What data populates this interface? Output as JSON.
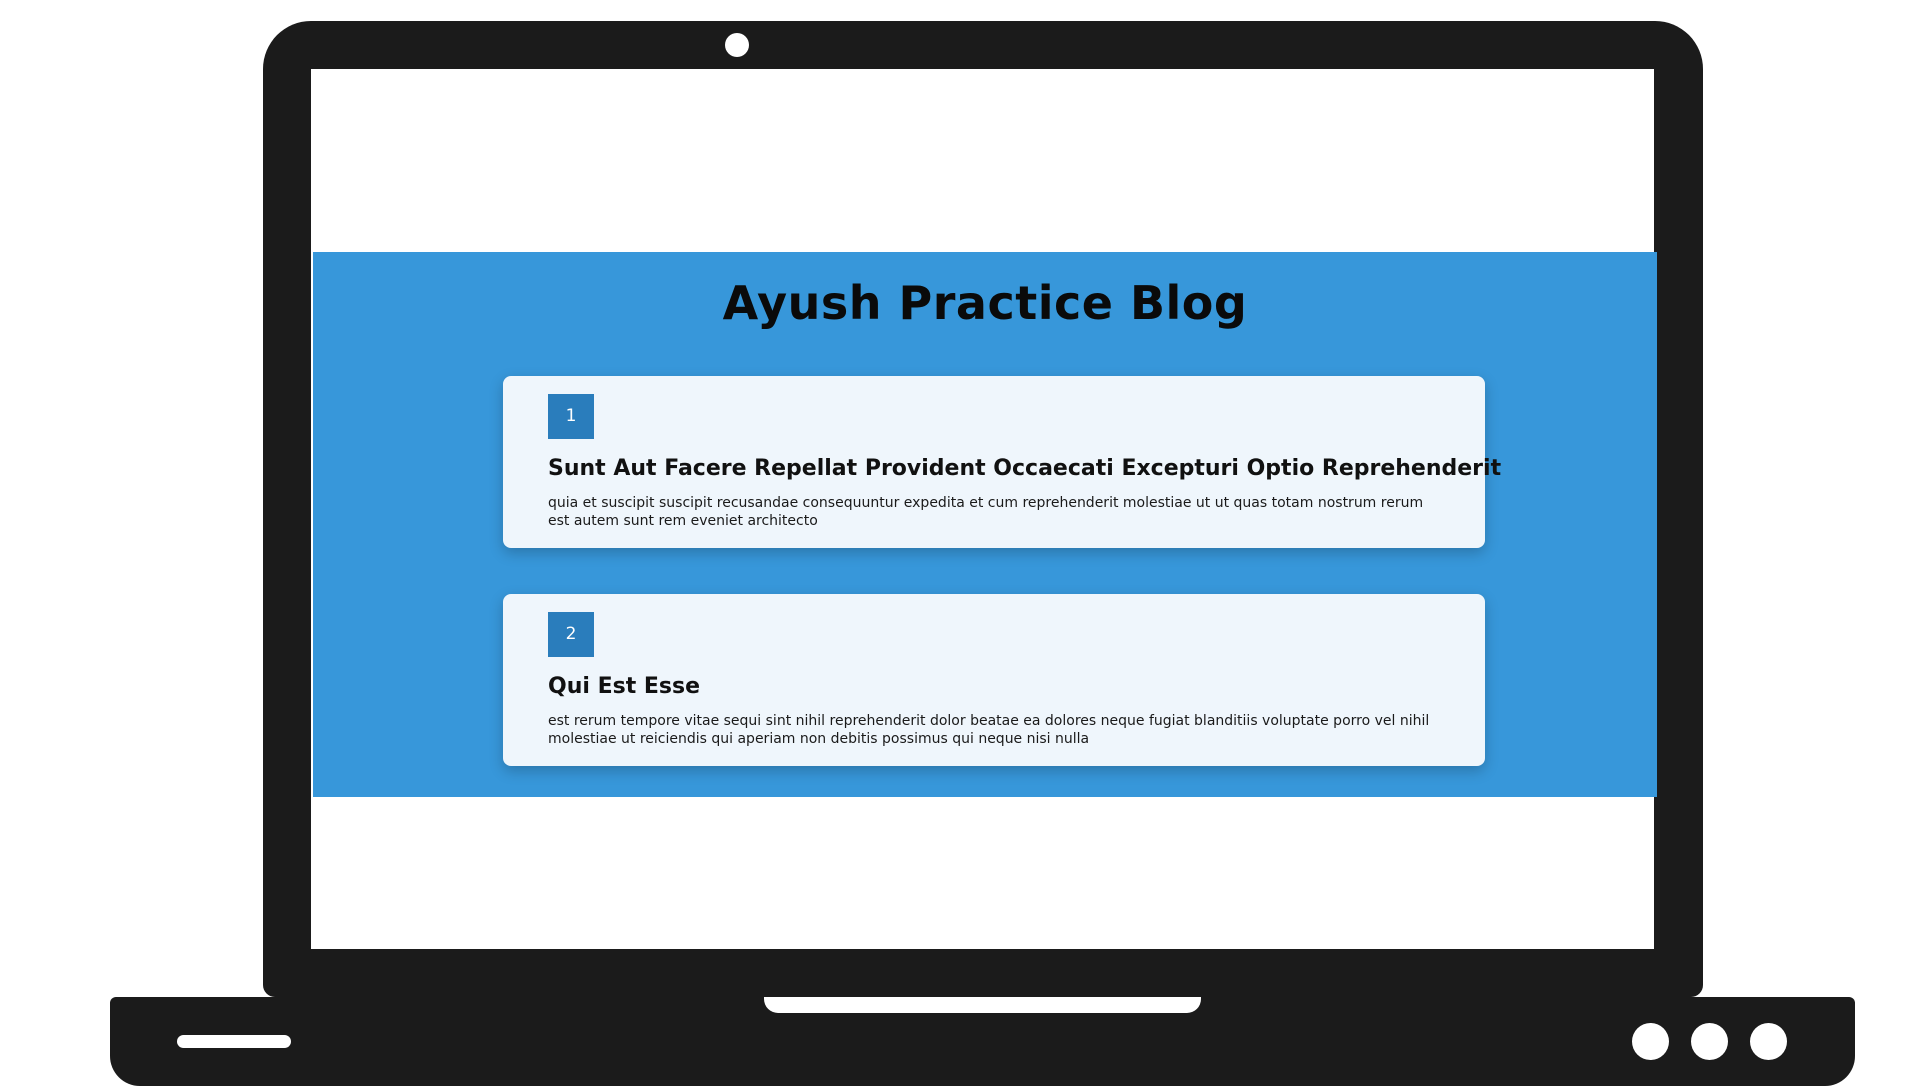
{
  "blog": {
    "title": "Ayush Practice Blog",
    "posts": [
      {
        "id": "1",
        "title": "Sunt Aut Facere Repellat Provident Occaecati Excepturi Optio Reprehenderit",
        "body": "quia et suscipit suscipit recusandae consequuntur expedita et cum reprehenderit molestiae ut ut quas totam nostrum rerum est autem sunt rem eveniet architecto"
      },
      {
        "id": "2",
        "title": "Qui Est Esse",
        "body": "est rerum tempore vitae sequi sint nihil reprehenderit dolor beatae ea dolores neque fugiat blanditiis voluptate porro vel nihil molestiae ut reiciendis qui aperiam non debitis possimus qui neque nisi nulla"
      }
    ]
  },
  "colors": {
    "section_background": "#3797da",
    "card_background": "#eff6fc",
    "badge_background": "#2a7dbc",
    "laptop_body": "#1b1b1b"
  },
  "icons": {
    "camera": "webcam-icon",
    "trackpad_notch": "laptop-notch",
    "speaker": "speaker-slot",
    "buttons": "indicator-dots"
  }
}
